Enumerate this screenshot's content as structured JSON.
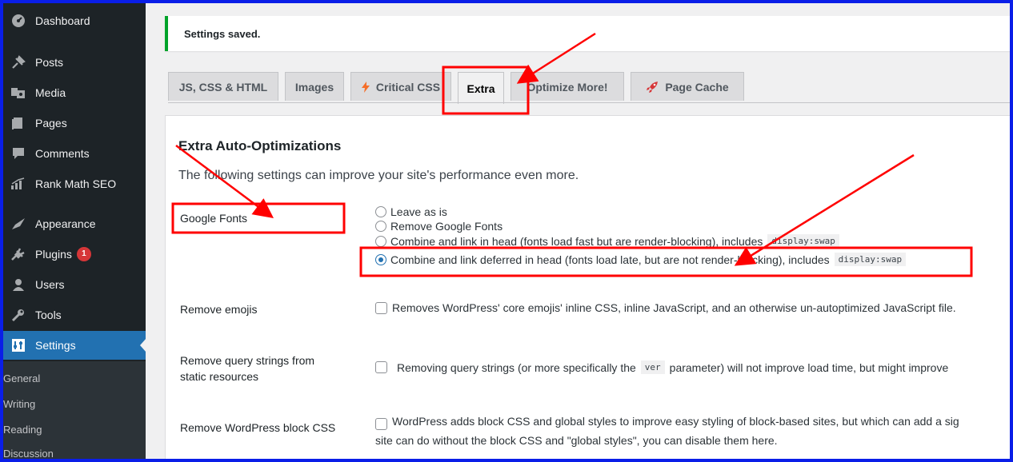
{
  "sidebar": {
    "items": [
      {
        "label": "Dashboard",
        "icon": "dashboard-icon"
      },
      {
        "label": "Posts",
        "icon": "pin-icon"
      },
      {
        "label": "Media",
        "icon": "media-icon"
      },
      {
        "label": "Pages",
        "icon": "pages-icon"
      },
      {
        "label": "Comments",
        "icon": "comments-icon"
      },
      {
        "label": "Rank Math SEO",
        "icon": "rank-math-icon"
      },
      {
        "label": "Appearance",
        "icon": "appearance-icon"
      },
      {
        "label": "Plugins",
        "icon": "plugins-icon",
        "badge": "1"
      },
      {
        "label": "Users",
        "icon": "users-icon"
      },
      {
        "label": "Tools",
        "icon": "tools-icon"
      },
      {
        "label": "Settings",
        "icon": "settings-icon",
        "active": true
      }
    ],
    "submenu": [
      "General",
      "Writing",
      "Reading",
      "Discussion"
    ]
  },
  "notice": {
    "text": "Settings saved."
  },
  "tabs": [
    {
      "label": "JS, CSS & HTML"
    },
    {
      "label": "Images"
    },
    {
      "label": "Critical CSS",
      "icon": "lightning-icon"
    },
    {
      "label": "Extra",
      "active": true
    },
    {
      "label": "Optimize More!"
    },
    {
      "label": "Page Cache",
      "icon": "rocket-icon"
    }
  ],
  "panel": {
    "title": "Extra Auto-Optimizations",
    "description": "The following settings can improve your site's performance even more.",
    "google_fonts": {
      "label": "Google Fonts",
      "options": [
        {
          "text": "Leave as is"
        },
        {
          "text": "Remove Google Fonts"
        },
        {
          "text": "Combine and link in head (fonts load fast but are render-blocking), includes",
          "code": "display:swap"
        },
        {
          "text": "Combine and link deferred in head (fonts load late, but are not render-blocking), includes",
          "code": "display:swap",
          "checked": true
        }
      ]
    },
    "remove_emojis": {
      "label": "Remove emojis",
      "text": "Removes WordPress' core emojis' inline CSS, inline JavaScript, and an otherwise un-autoptimized JavaScript file."
    },
    "remove_query_strings": {
      "label_line1": "Remove query strings from",
      "label_line2": "static resources",
      "text_before": "Removing query strings (or more specifically the",
      "code": "ver",
      "text_after": "parameter) will not improve load time, but might improve"
    },
    "remove_block_css": {
      "label": "Remove WordPress block CSS",
      "line1": "WordPress adds block CSS and global styles to improve easy styling of block-based sites, but which can add a sig",
      "line2": "site can do without the block CSS and \"global styles\", you can disable them here."
    }
  },
  "colors": {
    "admin_bar": "#1d2327",
    "accent": "#2271b1",
    "annotation": "#ff0000",
    "frame": "#0a1ee8"
  }
}
